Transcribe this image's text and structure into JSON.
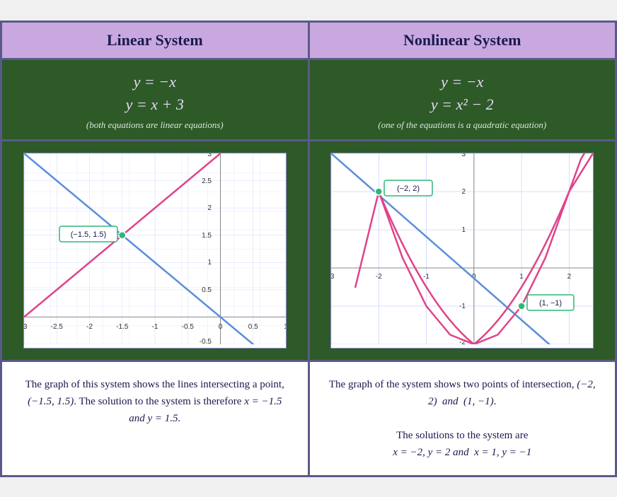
{
  "header": {
    "linear_title": "Linear System",
    "nonlinear_title": "Nonlinear System"
  },
  "linear": {
    "eq1": "y = −x",
    "eq2": "y = x + 3",
    "note": "(both equations are linear equations)",
    "description": "The graph of this system shows the lines intersecting a point, (−1.5, 1.5). The solution to the system is therefore x = −1.5 and y = 1.5.",
    "intersection": "(-1.5, 1.5)"
  },
  "nonlinear": {
    "eq1": "y = −x",
    "eq2": "y = x² − 2",
    "note": "(one of the equations is a quadratic equation)",
    "description_line1": "The graph of the system shows two points of intersection, (−2, 2) and (1, −1).",
    "description_line2": "The solutions to the system are",
    "description_line3": "x = −2, y = 2 and x = 1, y = −1",
    "point1": "(−2, 2)",
    "point2": "(1, −1)"
  }
}
